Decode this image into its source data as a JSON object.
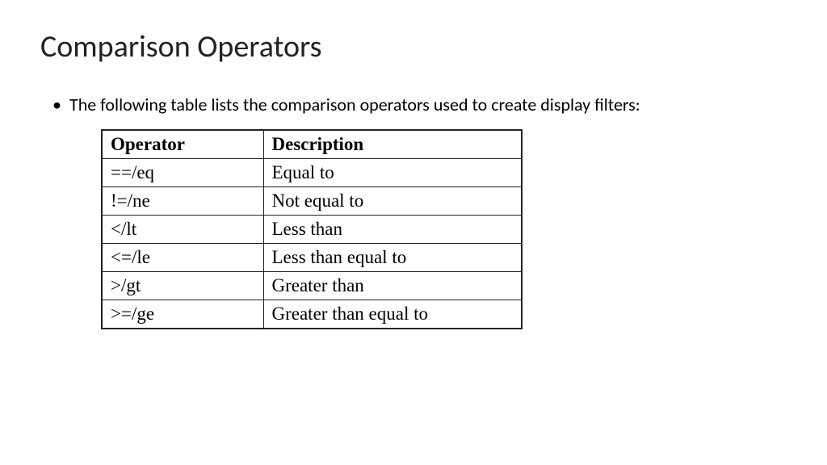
{
  "title": "Comparison Operators",
  "bullet": "The following table lists the comparison operators used to create display filters:",
  "table": {
    "headers": {
      "operator": "Operator",
      "description": "Description"
    },
    "rows": [
      {
        "operator": "==/eq",
        "description": "Equal to"
      },
      {
        "operator": "!=/ne",
        "description": "Not equal to"
      },
      {
        "operator": "</lt",
        "description": "Less than"
      },
      {
        "operator": "<=/le",
        "description": "Less than equal to"
      },
      {
        "operator": ">/gt",
        "description": "Greater than"
      },
      {
        "operator": ">=/ge",
        "description": "Greater than equal to"
      }
    ]
  }
}
